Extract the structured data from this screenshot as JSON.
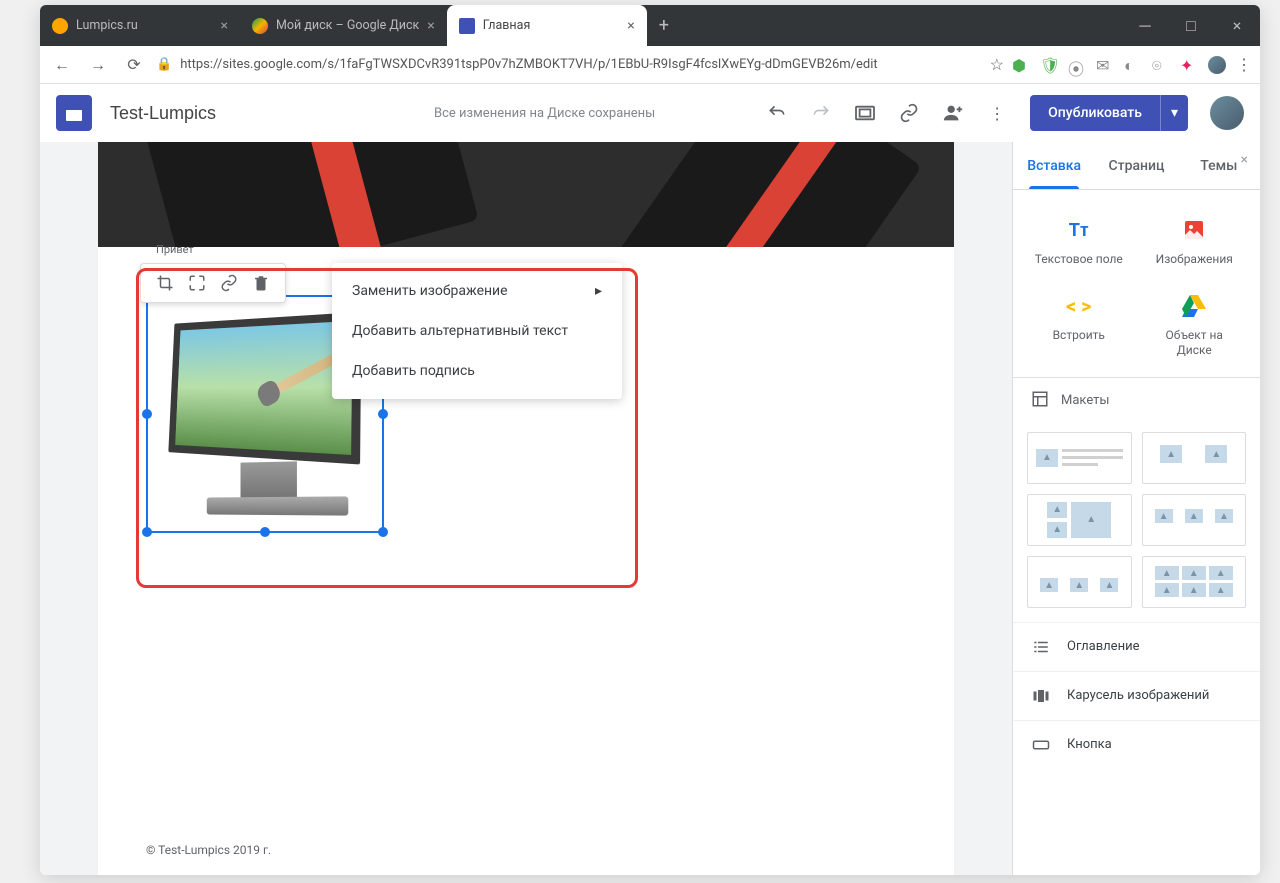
{
  "browser": {
    "tabs": [
      {
        "title": "Lumpics.ru",
        "icon_color": "#ffa500"
      },
      {
        "title": "Мой диск – Google Диск",
        "icon_color": "#0f9d58"
      },
      {
        "title": "Главная",
        "icon_color": "#3f51b5",
        "active": true
      }
    ],
    "url": "https://sites.google.com/s/1faFgTWSXDCvR391tspP0v7hZMBOKT7VH/p/1EBbU-R9IsgF4fcslXwEYg-dDmGEVB26m/edit"
  },
  "app": {
    "site_title": "Test-Lumpics",
    "save_status": "Все изменения на Диске сохранены",
    "publish_label": "Опубликовать"
  },
  "image_toolbar": {
    "hint_label": "Привет",
    "menu": {
      "replace": "Заменить изображение",
      "alt_text": "Добавить альтернативный текст",
      "caption": "Добавить подпись"
    }
  },
  "footer": "© Test-Lumpics 2019 г.",
  "sidebar": {
    "tabs": {
      "insert": "Вставка",
      "pages": "Страниц",
      "themes": "Темы"
    },
    "insert": {
      "text_box": "Текстовое поле",
      "images": "Изображения",
      "embed": "Встроить",
      "drive": "Объект на Диске"
    },
    "layouts_label": "Макеты",
    "list": {
      "toc": "Оглавление",
      "carousel": "Карусель изображений",
      "button": "Кнопка"
    }
  }
}
